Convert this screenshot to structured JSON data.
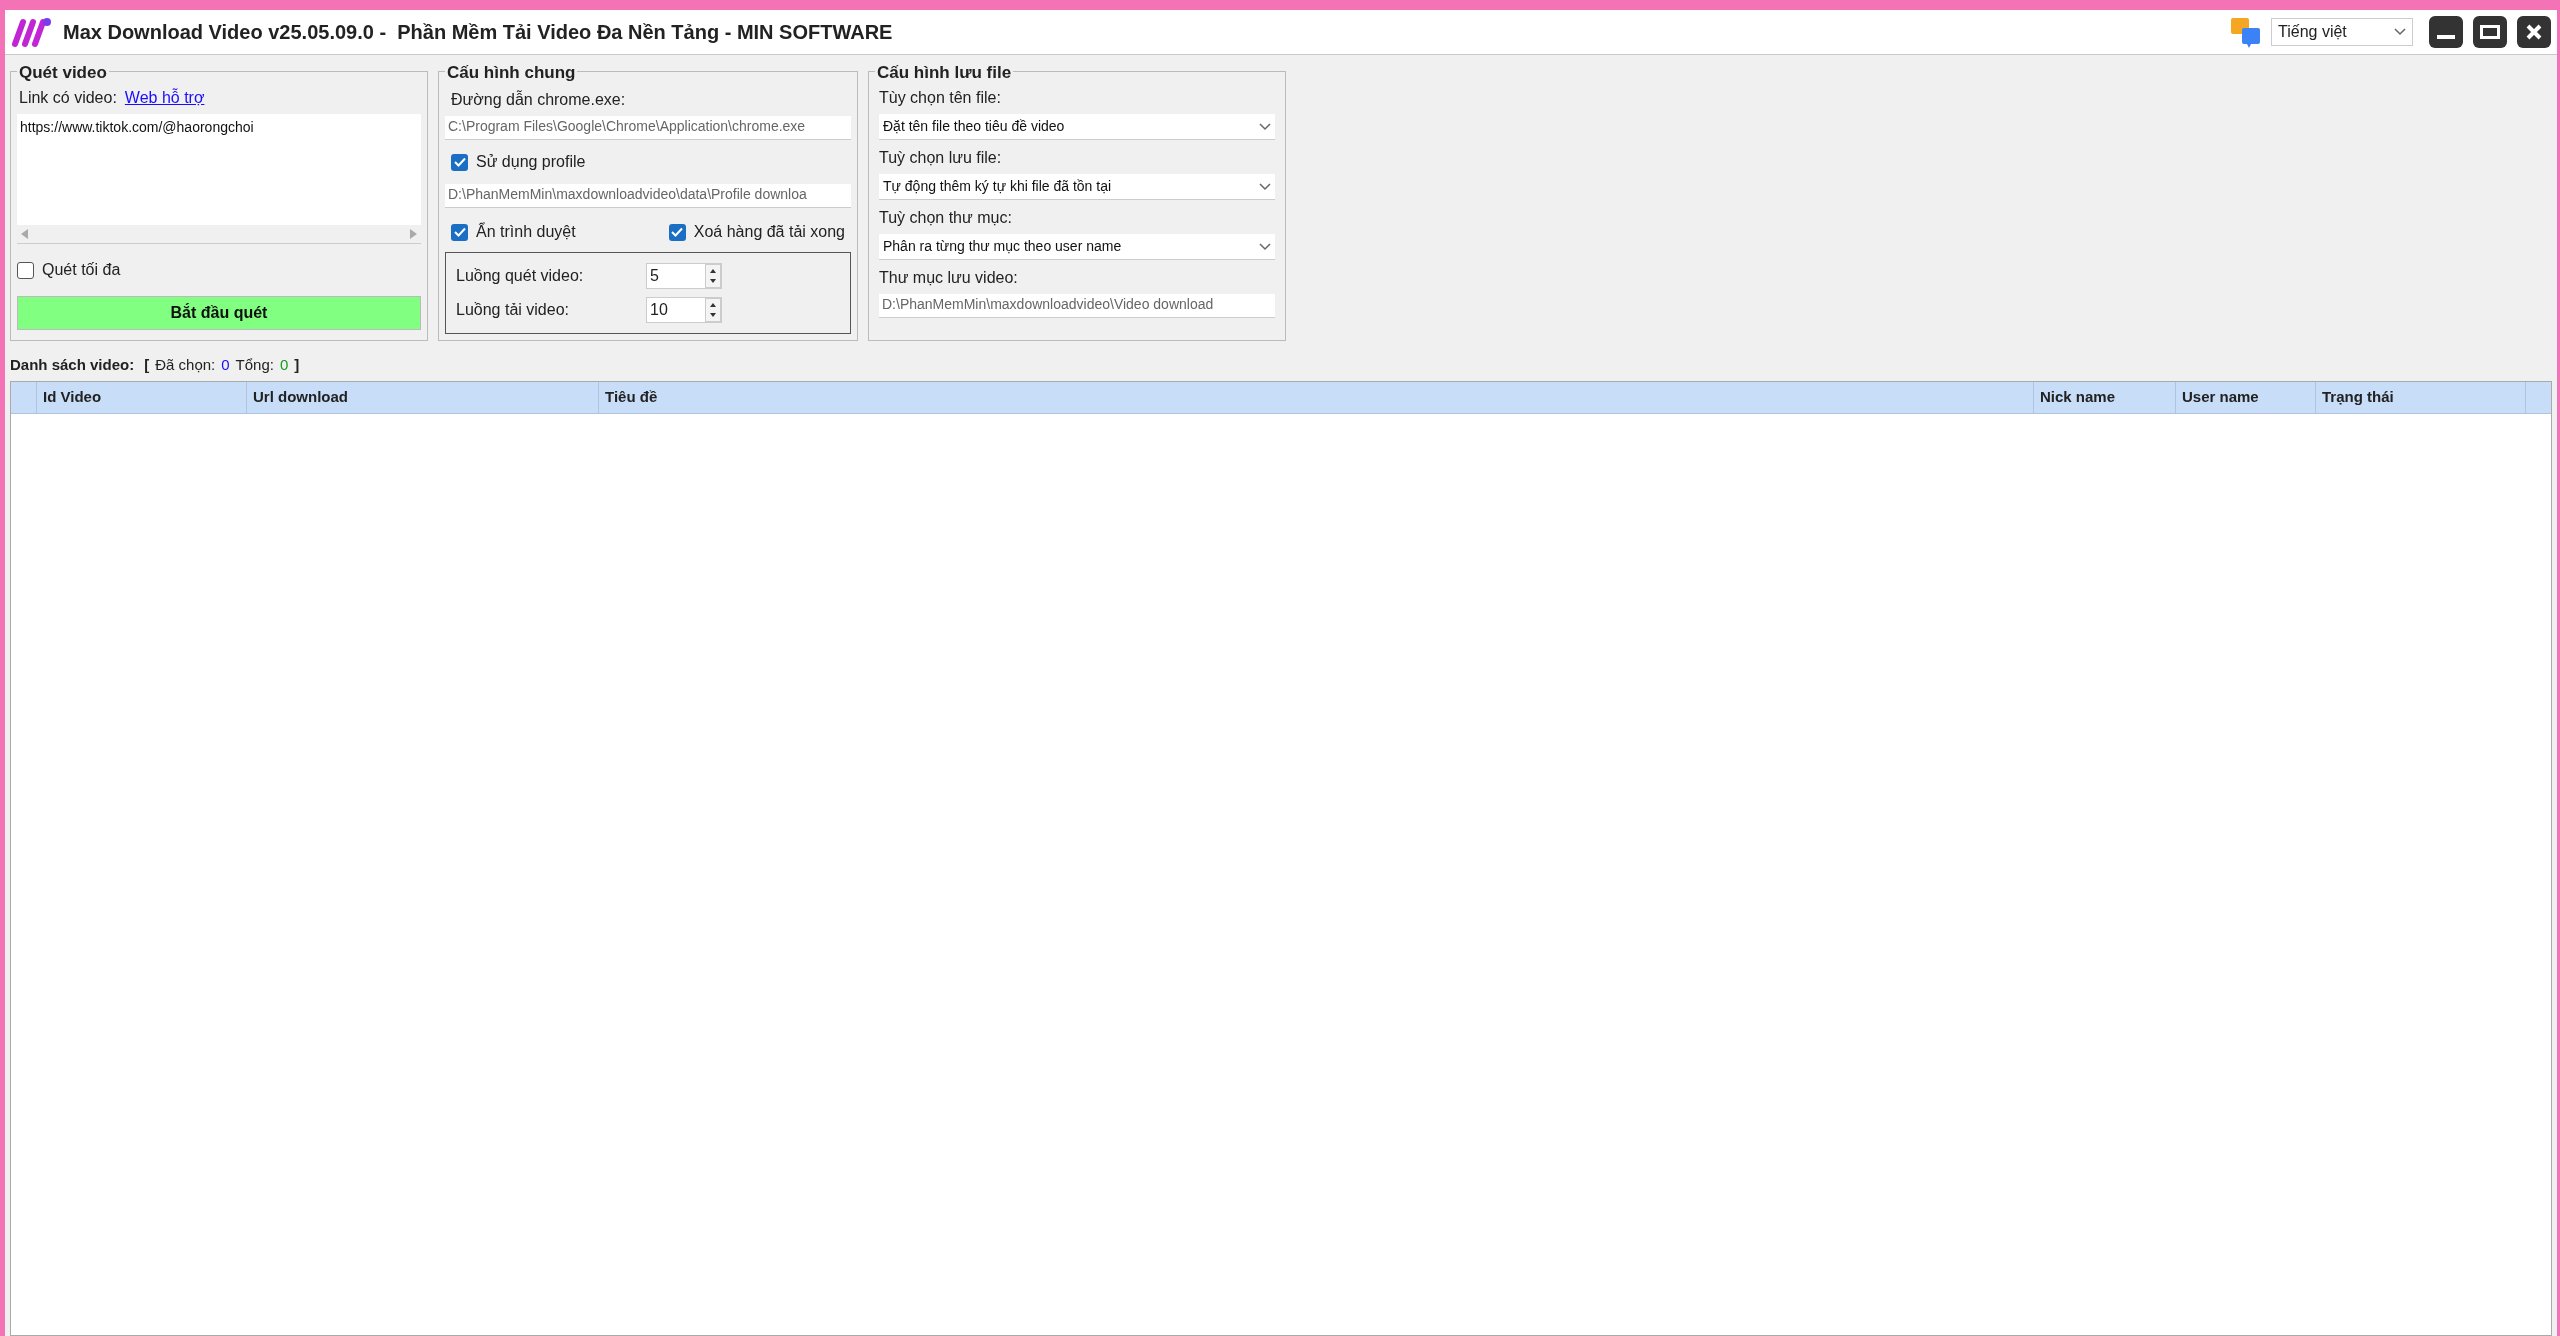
{
  "window": {
    "title": "Max Download Video v25.05.09.0 -  Phần Mềm Tải Video Đa Nền Tảng - MIN SOFTWARE",
    "language": "Tiếng việt"
  },
  "scan": {
    "title": "Quét video",
    "link_label": "Link có video:",
    "link": "Web hỗ trợ",
    "urls": "https://www.tiktok.com/@haorongchoi",
    "max_scan": {
      "label": "Quét tối đa",
      "checked": false
    },
    "start_button": "Bắt đầu quét"
  },
  "general": {
    "title": "Cấu hình chung",
    "chrome_label": "Đường dẫn chrome.exe:",
    "chrome_path": "C:\\Program Files\\Google\\Chrome\\Application\\chrome.exe",
    "use_profile": {
      "label": "Sử dụng profile",
      "checked": true
    },
    "profile_path": "D:\\PhanMemMin\\maxdownloadvideo\\data\\Profile downloa",
    "hide_browser": {
      "label": "Ẩn trình duyệt",
      "checked": true
    },
    "remove_done": {
      "label": "Xoá hàng đã tải xong",
      "checked": true
    },
    "threads": [
      {
        "label": "Luồng quét video:",
        "value": "5"
      },
      {
        "label": "Luồng tải video:",
        "value": "10"
      }
    ]
  },
  "save": {
    "title": "Cấu hình lưu file",
    "fields": [
      {
        "kind": "select",
        "label": "Tùy chọn tên file:",
        "value": "Đặt tên file theo tiêu đề video"
      },
      {
        "kind": "select",
        "label": "Tuỳ chọn lưu file:",
        "value": "Tự động thêm ký tự khi file đã tồn tại"
      },
      {
        "kind": "select",
        "label": "Tuỳ chọn thư mục:",
        "value": "Phân ra từng thư mục theo user name"
      },
      {
        "kind": "text",
        "label": "Thư mục lưu video:",
        "value": "D:\\PhanMemMin\\maxdownloadvideo\\Video download"
      }
    ]
  },
  "list": {
    "label": "Danh sách video:",
    "open_bracket": "[",
    "selected_label": "Đã chọn:",
    "selected_count": "0",
    "total_label": "Tổng:",
    "total_count": "0",
    "close_bracket": "]"
  },
  "table": {
    "columns": [
      "Id Video",
      "Url download",
      "Tiêu đề",
      "Nick name",
      "User name",
      "Trạng thái"
    ]
  }
}
